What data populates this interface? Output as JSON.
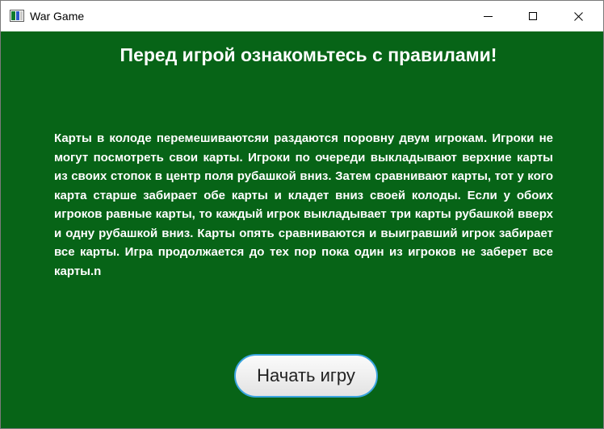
{
  "window": {
    "title": "War Game",
    "icon": "app-window-icon",
    "controls": {
      "minimize_icon": "minimize-icon",
      "maximize_icon": "maximize-icon",
      "close_icon": "close-icon",
      "close_glyph": "✕"
    }
  },
  "main": {
    "heading": "Перед игрой ознакомьтесь с правилами!",
    "rules_text": "Карты в колоде перемешиваютсяи раздаются поровну двум игрокам. Игроки не могут посмотреть свои карты. Игроки по очереди выкладывают верхние карты из своих стопок в центр поля рубашкой вниз. Затем сравнивают карты, тот у кого карта старше забирает обе карты и кладет вниз своей колоды. Если у обоих игроков равные карты, то каждый игрок выкладывает три карты рубашкой вверх и одну рубашкой вниз. Карты опять сравниваются и выигравший игрок забирает все карты. Игра продолжается до тех пор пока один из игроков не заберет все карты.n",
    "start_button_label": "Начать игру"
  },
  "colors": {
    "background": "#076417",
    "text": "#ffffff",
    "button_border": "#3aa4de",
    "button_fill": "#efefef"
  }
}
